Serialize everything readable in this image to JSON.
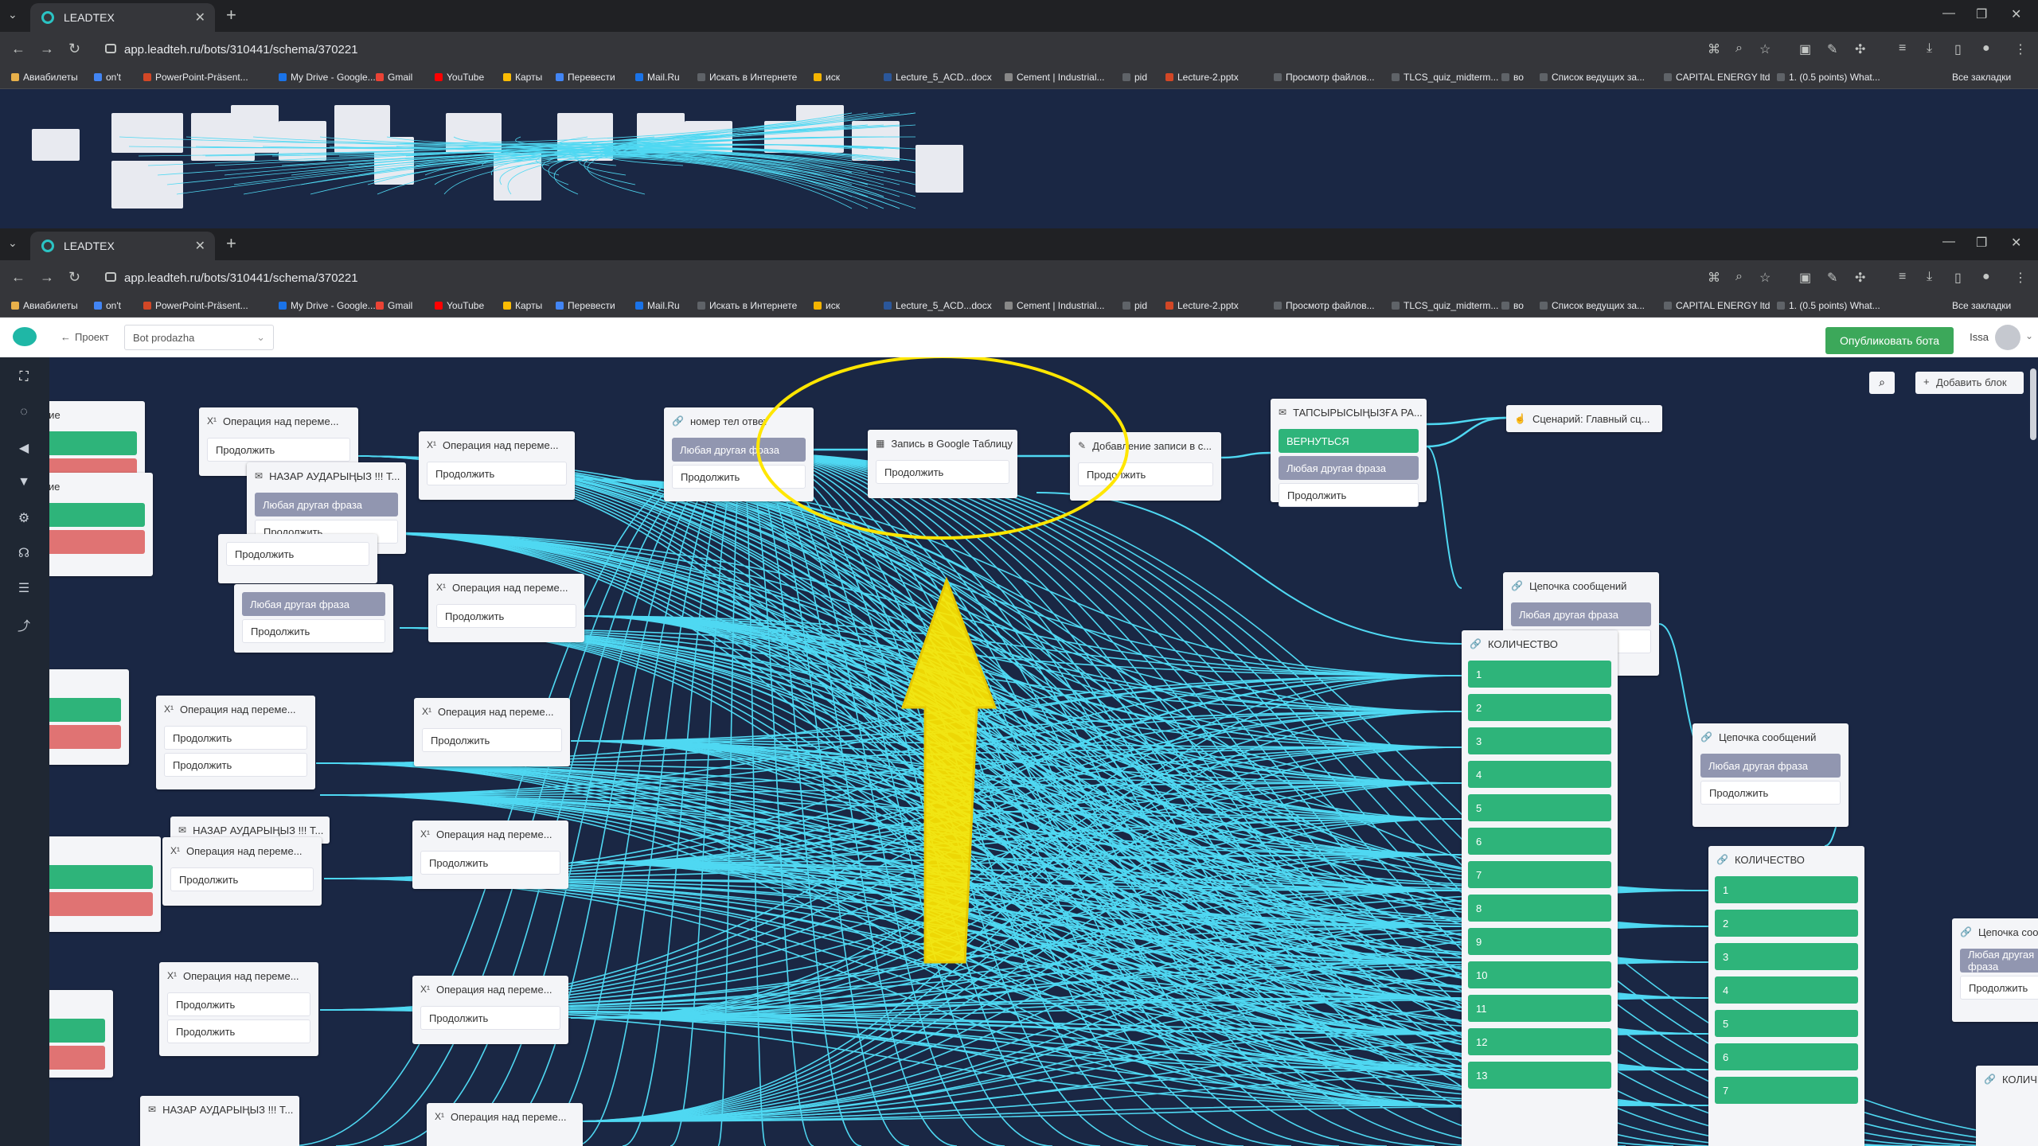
{
  "browser": {
    "tab_title": "LEADTEX",
    "url": "app.leadteh.ru/bots/310441/schema/370221",
    "bookmarks": [
      "Авиабилеты",
      "on't",
      "PowerPoint-Präsent...",
      "My Drive - Google...",
      "Gmail",
      "YouTube",
      "Карты",
      "Перевести",
      "Mail.Ru",
      "Искать в Интернете",
      "иск",
      "Lecture_5_ACD...docx",
      "Cement | Industrial...",
      "pid",
      "Lecture-2.pptx",
      "Просмотр файлов...",
      "TLCS_quiz_midterm...",
      "во",
      "Список ведущих за...",
      "CAPITAL ENERGY ltd",
      "1. (0.5 points) What..."
    ],
    "all_bookmarks": "Все закладки"
  },
  "app": {
    "project_link": "Проект",
    "bot_select": "Bot prodazha",
    "publish": "Опубликовать бота",
    "user": "Issa",
    "add_block": "Добавить блок"
  },
  "labels": {
    "cont": "Продолжить",
    "any": "Любая другая фраза",
    "op": "Операция над переме...",
    "nazar": "НАЗАР АУДАРЫҢЫЗ !!! Т...",
    "chain": "Цепочка сообщений",
    "qty": "КОЛИЧЕСТВО"
  },
  "nodes": {
    "phone": "номер тел ответ",
    "gsheet": "Запись в Google Таблицу",
    "add_record": "Добавление записи в с...",
    "order": "ТАПСЫРЫСЫҢЫЗҒА РА...",
    "back": "ВЕРНУТЬСЯ",
    "scenario": "Сценарий: Главный сц..."
  },
  "qty_list_1": [
    "1",
    "2",
    "3",
    "4",
    "5",
    "6",
    "7",
    "8",
    "9",
    "10",
    "11",
    "12",
    "13"
  ],
  "qty_list_2": [
    "1",
    "2",
    "3",
    "4",
    "5",
    "6",
    "7"
  ],
  "colors": {
    "canvas": "#1a2744",
    "edge": "#4fd8f2",
    "green": "#2eb47a",
    "red": "#e07373",
    "highlight": "#ffe600"
  }
}
